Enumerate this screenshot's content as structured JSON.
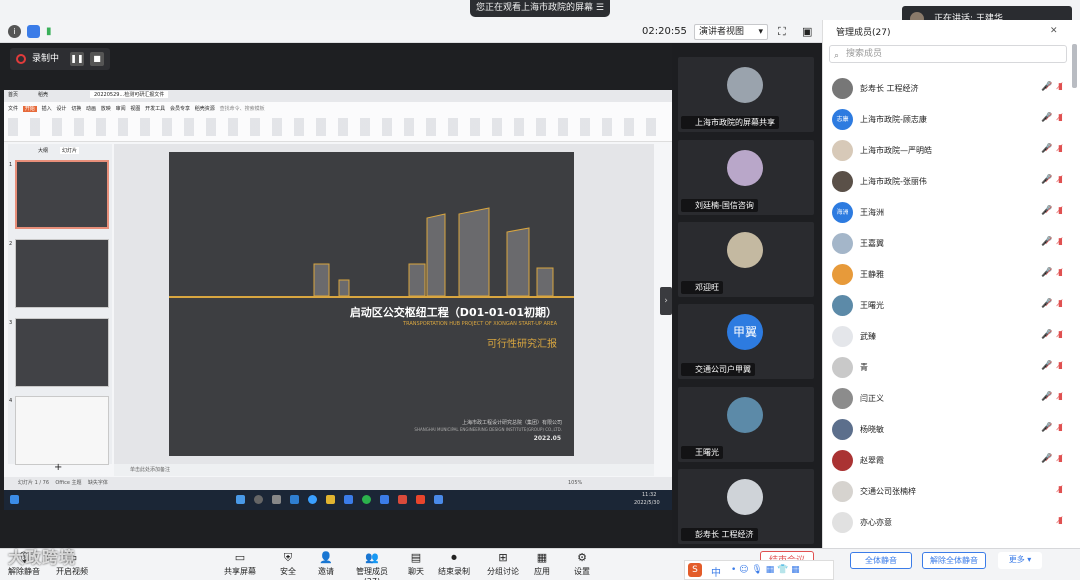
{
  "banner": {
    "watching": "您正在观看上海市政院的屏幕",
    "speaking_prefix": "正在讲话:",
    "speaking_name": "王建华"
  },
  "toolbar": {
    "timer": "02:20:55",
    "view_mode": "演讲者视图",
    "recording": "录制中"
  },
  "colors": {
    "accent": "#3b7ce8",
    "muted_red": "#e05050",
    "slide_gold": "#d9a640",
    "record_red": "#e23b3b"
  },
  "wps": {
    "tabs": [
      "首页",
      "稻壳",
      "20220529...检测可研汇报文件"
    ],
    "ribbon_tabs": [
      "文件",
      "开始",
      "插入",
      "设计",
      "切换",
      "动画",
      "放映",
      "审阅",
      "视图",
      "开发工具",
      "会员专享",
      "稻壳资源"
    ],
    "search_placeholder": "查找命令、搜索模板",
    "panel_tabs": [
      "大纲",
      "幻灯片"
    ],
    "notes_placeholder": "单击此处添加备注",
    "status": [
      "幻灯片 1 / 76",
      "Office 主题",
      "缺失字体"
    ],
    "zoom": "105%",
    "taskbar_time": "11:32",
    "taskbar_date": "2022/5/30"
  },
  "slide": {
    "title": "启动区公交枢纽工程（D01-01-01初期）",
    "subtitle_en": "TRANSPORTATION HUB PROJECT OF XIONGAN START-UP AREA",
    "report": "可行性研究汇报",
    "company": "上海市政工程设计研究总院（集团）有限公司",
    "company_en": "SHANGHAI MUNICIPAL ENGINEERING DESIGN INSTITUTE(GROUP) CO.,LTD.",
    "date": "2022.05"
  },
  "thumbnails": [
    "1",
    "2",
    "3",
    "4"
  ],
  "video_tiles": [
    {
      "label": "上海市政院的屏幕共享"
    },
    {
      "label": "刘廷楠-国信咨询"
    },
    {
      "label": "邓迎旺"
    },
    {
      "label": "交通公司户甲翼",
      "avatar_text": "甲翼"
    },
    {
      "label": "王曙光"
    },
    {
      "label": "彭寿长 工程经济"
    }
  ],
  "panel": {
    "title": "管理成员(27)",
    "search_placeholder": "搜索成员",
    "members": [
      {
        "name": "彭寿长 工程经济"
      },
      {
        "name": "上海市政院-顾志康",
        "avatar_text": "志康"
      },
      {
        "name": "上海市政院—严明皓"
      },
      {
        "name": "上海市政院-张丽伟"
      },
      {
        "name": "王海洲",
        "avatar_text": "海洲"
      },
      {
        "name": "王嘉翼"
      },
      {
        "name": "王静雅"
      },
      {
        "name": "王曙光"
      },
      {
        "name": "武臻"
      },
      {
        "name": "青"
      },
      {
        "name": "闫正义"
      },
      {
        "name": "杨晓敏"
      },
      {
        "name": "赵翠霞"
      },
      {
        "name": "交通公司张楠梓"
      },
      {
        "name": "亦心亦意"
      }
    ],
    "mute_all": "全体静音",
    "unmute_all": "解除全体静音",
    "more": "更多"
  },
  "bottom": {
    "items": [
      "解除静音",
      "开启视频",
      "共享屏幕",
      "安全",
      "邀请",
      "管理成员(27)",
      "聊天",
      "结束录制",
      "分组讨论",
      "应用",
      "设置"
    ],
    "end_meeting": "结束会议"
  },
  "watermark": "大政跨境"
}
